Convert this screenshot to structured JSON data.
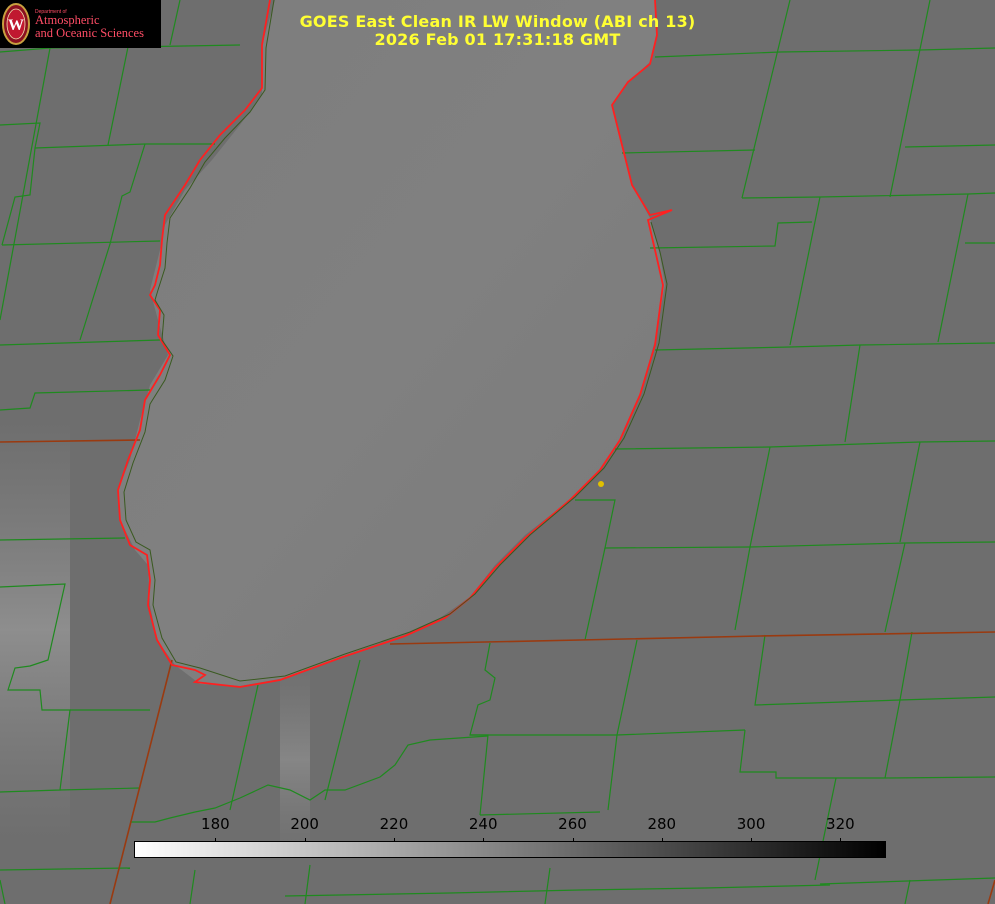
{
  "title": {
    "line1": "GOES East Clean IR LW Window (ABI ch 13)",
    "line2": "2026 Feb 01 17:31:18 GMT"
  },
  "logo": {
    "small_text": "Department of",
    "line1": "Atmospheric",
    "line2": "and Oceanic Sciences",
    "seal_letter": "W",
    "color": "#ff4d66"
  },
  "colorbar": {
    "ticks": [
      "180",
      "200",
      "220",
      "240",
      "260",
      "280",
      "300",
      "320"
    ],
    "range": [
      162,
      330
    ],
    "colormap": "white-to-black grayscale"
  },
  "colors": {
    "title": "#ffff33",
    "county_lines": "#1f8a1f",
    "coastline": "#ff2020",
    "state_lines": "#9a3a10",
    "marker": "#e0c000"
  }
}
